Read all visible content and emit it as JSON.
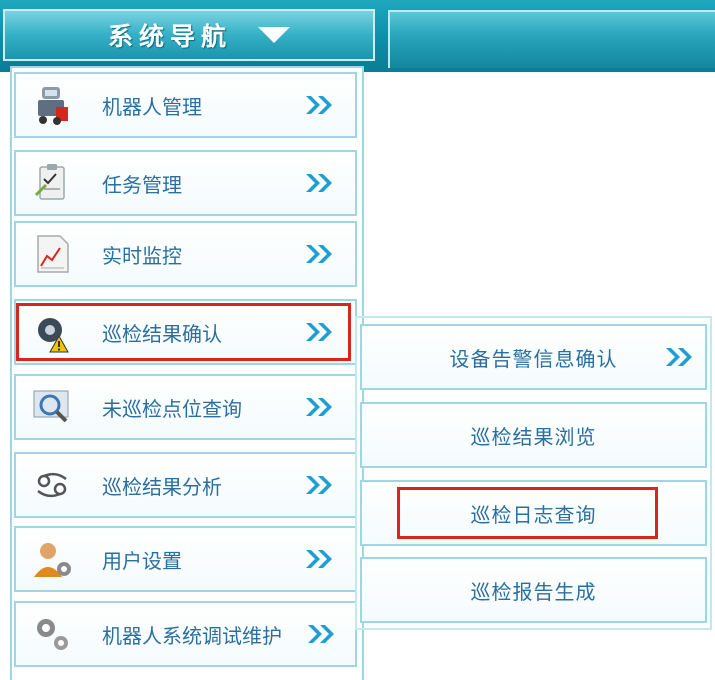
{
  "header": {
    "nav_title": "系统导航"
  },
  "menu": {
    "items": [
      {
        "label": "机器人管理",
        "icon": "robot-icon"
      },
      {
        "label": "任务管理",
        "icon": "clipboard-icon"
      },
      {
        "label": "实时监控",
        "icon": "chart-document-icon"
      },
      {
        "label": "巡检结果确认",
        "icon": "gear-warning-icon"
      },
      {
        "label": "未巡检点位查询",
        "icon": "magnifier-icon"
      },
      {
        "label": "巡检结果分析",
        "icon": "cancer-symbol-icon"
      },
      {
        "label": "用户设置",
        "icon": "user-gear-icon"
      },
      {
        "label": "机器人系统调试维护",
        "icon": "gears-icon"
      }
    ]
  },
  "submenu": {
    "items": [
      {
        "label": "设备告警信息确认"
      },
      {
        "label": "巡检结果浏览"
      },
      {
        "label": "巡检日志查询"
      },
      {
        "label": "巡检报告生成"
      }
    ]
  },
  "colors": {
    "accent": "#0d8ea8",
    "highlight": "#d9261c",
    "text": "#2b6fa0",
    "arrow": "#1f9ed3"
  }
}
